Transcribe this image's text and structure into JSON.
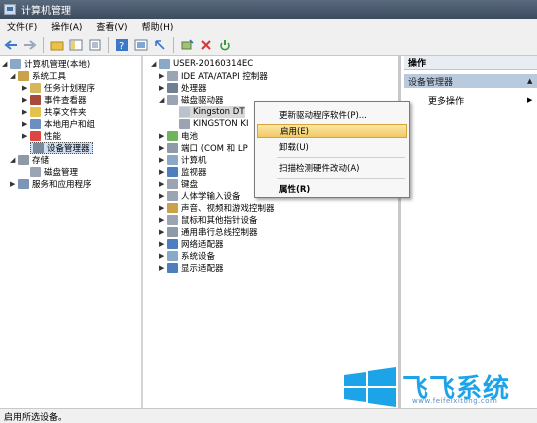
{
  "window": {
    "title": "计算机管理"
  },
  "menu": [
    "文件(F)",
    "操作(A)",
    "查看(V)",
    "帮助(H)"
  ],
  "toolbar_icons": [
    "back-icon",
    "forward-icon",
    "up-folder-icon",
    "show-hide-tree-icon",
    "properties-icon",
    "help-icon",
    "view-icon",
    "scan-hardware-icon",
    "update-driver-icon",
    "uninstall-icon",
    "enable-icon"
  ],
  "left_tree": {
    "root": "计算机管理(本地)",
    "system_tools": "系统工具",
    "items": [
      "任务计划程序",
      "事件查看器",
      "共享文件夹",
      "本地用户和组",
      "性能",
      "设备管理器"
    ],
    "storage": "存储",
    "disk_mgmt": "磁盘管理",
    "services": "服务和应用程序"
  },
  "device_tree": {
    "computer": "USER-20160314EC",
    "ide": "IDE ATA/ATAPI 控制器",
    "cpu": "处理器",
    "disk_drives": "磁盘驱动器",
    "kingston1": "Kingston DT",
    "kingston2": "KINGSTON KI",
    "battery": "电池",
    "ports": "端口 (COM 和 LP",
    "computer_node": "计算机",
    "monitor": "监视器",
    "keyboard": "键盘",
    "hid": "人体学输入设备",
    "sound": "声音、视频和游戏控制器",
    "mouse": "鼠标和其他指针设备",
    "usb": "通用串行总线控制器",
    "network": "网络适配器",
    "system": "系统设备",
    "display": "显示适配器"
  },
  "context_menu": {
    "update": "更新驱动程序软件(P)...",
    "enable": "启用(E)",
    "uninstall": "卸载(U)",
    "scan": "扫描检测硬件改动(A)",
    "properties": "属性(R)"
  },
  "actions": {
    "header": "操作",
    "device_manager": "设备管理器",
    "more": "更多操作"
  },
  "status": "启用所选设备。",
  "watermark": {
    "text": "飞飞系统",
    "url": "www.feifeixitong.com"
  },
  "colors": {
    "titlebar": "#4a596c",
    "selection": "#cfe0f4",
    "menu_highlight": "#f1c963",
    "watermark": "#1da3e8"
  }
}
